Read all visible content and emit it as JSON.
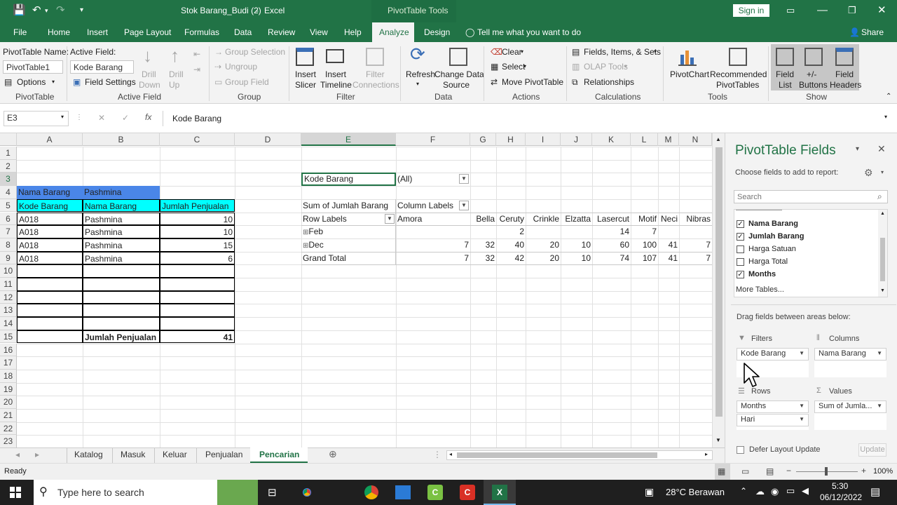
{
  "title_bar": {
    "file": "Stok Barang_Budi (2)",
    "separator": " - ",
    "app": "Excel",
    "contextual": "PivotTable Tools",
    "signin": "Sign in"
  },
  "menu": {
    "tabs": [
      "File",
      "Home",
      "Insert",
      "Page Layout",
      "Formulas",
      "Data",
      "Review",
      "View",
      "Help",
      "Analyze",
      "Design"
    ],
    "tell_me": "Tell me what you want to do",
    "share": "Share"
  },
  "ribbon": {
    "pt_name_label": "PivotTable Name:",
    "pt_name_value": "PivotTable1",
    "options": "Options",
    "grp_pivottable": "PivotTable",
    "active_field_label": "Active Field:",
    "active_field_value": "Kode Barang",
    "field_settings": "Field Settings",
    "drill_down": [
      "Drill",
      "Down"
    ],
    "drill_up": [
      "Drill",
      "Up"
    ],
    "grp_active_field": "Active Field",
    "group_selection": "Group Selection",
    "ungroup": "Ungroup",
    "group_field": "Group Field",
    "grp_group": "Group",
    "insert_slicer": [
      "Insert",
      "Slicer"
    ],
    "insert_timeline": [
      "Insert",
      "Timeline"
    ],
    "filter_connections": [
      "Filter",
      "Connections"
    ],
    "grp_filter": "Filter",
    "refresh": "Refresh",
    "change_data_source": [
      "Change Data",
      "Source"
    ],
    "grp_data": "Data",
    "clear": "Clear",
    "select": "Select",
    "move_pivottable": "Move PivotTable",
    "grp_actions": "Actions",
    "fields_items_sets": "Fields, Items, & Sets",
    "olap_tools": "OLAP Tools",
    "relationships": "Relationships",
    "grp_calculations": "Calculations",
    "pivotchart": "PivotChart",
    "recommended": [
      "Recommended",
      "PivotTables"
    ],
    "grp_tools": "Tools",
    "field_list": [
      "Field",
      "List"
    ],
    "buttons": [
      "+/-",
      "Buttons"
    ],
    "field_headers": [
      "Field",
      "Headers"
    ],
    "grp_show": "Show"
  },
  "formula": {
    "name_box": "E3",
    "cancel": "✕",
    "enter": "✓",
    "fx": "fx",
    "content": "Kode Barang"
  },
  "columns": [
    "A",
    "B",
    "C",
    "D",
    "E",
    "F",
    "G",
    "H",
    "I",
    "J",
    "K",
    "L",
    "M",
    "N"
  ],
  "rows": [
    "1",
    "2",
    "3",
    "4",
    "5",
    "6",
    "7",
    "8",
    "9",
    "10",
    "11",
    "12",
    "13",
    "14",
    "15",
    "16",
    "17",
    "18",
    "19",
    "20",
    "21",
    "22",
    "23"
  ],
  "table": {
    "r4": [
      "Nama Barang",
      "Pashmina"
    ],
    "r5": [
      "Kode Barang",
      "Nama Barang",
      "Jumlah Penjualan"
    ],
    "data": [
      [
        "A018",
        "Pashmina",
        "10"
      ],
      [
        "A018",
        "Pashmina",
        "10"
      ],
      [
        "A018",
        "Pashmina",
        "15"
      ],
      [
        "A018",
        "Pashmina",
        "6"
      ]
    ],
    "total_label": "Jumlah Penjualan",
    "total_value": "41"
  },
  "pivot": {
    "filter_label": "Kode Barang",
    "filter_value": "(All)",
    "sum_label": "Sum of Jumlah Barang",
    "col_labels": "Column Labels",
    "row_labels": "Row Labels",
    "col_headers": [
      "Amora",
      "Bella",
      "Ceruty",
      "Crinkle",
      "Elzatta",
      "Lasercut",
      "Motif",
      "Neci",
      "Nibras"
    ],
    "rows": [
      {
        "label": "Feb",
        "values": [
          "",
          "",
          "2",
          "",
          "",
          "14",
          "7",
          "",
          ""
        ]
      },
      {
        "label": "Dec",
        "values": [
          "7",
          "32",
          "40",
          "20",
          "10",
          "60",
          "100",
          "41",
          "7"
        ]
      }
    ],
    "grand_total_label": "Grand Total",
    "grand_total": [
      "7",
      "32",
      "42",
      "20",
      "10",
      "74",
      "107",
      "41",
      "7"
    ],
    "expand": "⊞"
  },
  "sheets": {
    "tabs": [
      "Katalog",
      "Masuk",
      "Keluar",
      "Penjualan",
      "Pencarian"
    ],
    "active": "Pencarian"
  },
  "status": {
    "ready": "Ready",
    "zoom": "100%"
  },
  "pane": {
    "title": "PivotTable Fields",
    "choose": "Choose fields to add to report:",
    "search_placeholder": "Search",
    "fields": [
      {
        "name": "Nama Barang",
        "checked": "✓"
      },
      {
        "name": "Jumlah Barang",
        "checked": "✓"
      },
      {
        "name": "Harga Satuan",
        "checked": ""
      },
      {
        "name": "Harga Total",
        "checked": ""
      },
      {
        "name": "Months",
        "checked": "✓"
      }
    ],
    "more_tables": "More Tables...",
    "drag": "Drag fields between areas below:",
    "filters_label": "Filters",
    "columns_label": "Columns",
    "rows_label": "Rows",
    "values_label": "Values",
    "filters": [
      "Kode Barang"
    ],
    "columns": [
      "Nama Barang"
    ],
    "rows": [
      "Months",
      "Hari"
    ],
    "values": [
      "Sum of Jumla..."
    ],
    "defer": "Defer Layout Update",
    "update": "Update"
  },
  "taskbar": {
    "search": "Type here to search",
    "weather": "28°C  Berawan",
    "time": "5:30",
    "date": "06/12/2022"
  },
  "colors": {
    "excel_green": "#217346",
    "header_blue": "#4a86e8",
    "header_cyan": "#00ffff"
  }
}
